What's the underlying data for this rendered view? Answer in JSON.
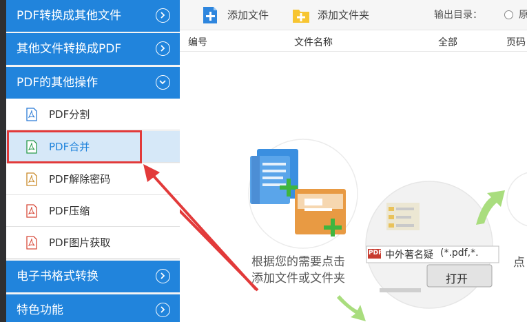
{
  "sidebar": {
    "categories_top": [
      {
        "label": "PDF转换成其他文件"
      },
      {
        "label": "其他文件转换成PDF"
      },
      {
        "label": "PDF的其他操作"
      }
    ],
    "sub_items": [
      {
        "label": "PDF分割",
        "icon": "pdf-file-icon",
        "color": "#2b7bd6"
      },
      {
        "label": "PDF合并",
        "icon": "pdf-file-icon",
        "color": "#2a9a4a"
      },
      {
        "label": "PDF解除密码",
        "icon": "pdf-file-icon",
        "color": "#c98a2a"
      },
      {
        "label": "PDF压缩",
        "icon": "pdf-file-icon",
        "color": "#d84a3a"
      },
      {
        "label": "PDF图片获取",
        "icon": "pdf-file-icon",
        "color": "#d84a3a"
      }
    ],
    "categories_bottom": [
      {
        "label": "电子书格式转换"
      },
      {
        "label": "特色功能"
      }
    ],
    "accent_color": "#2184dc",
    "active_item": "PDF合并"
  },
  "toolbar": {
    "add_file_label": "添加文件",
    "add_folder_label": "添加文件夹",
    "output_dir_label": "输出目录：",
    "output_option_label": "原"
  },
  "table": {
    "columns": [
      "编号",
      "文件名称",
      "全部",
      "页码"
    ]
  },
  "illustration": {
    "hint_line1": "根据您的需要点击",
    "hint_line2": "添加文件或文件夹",
    "hint_right": "点",
    "dialog_filename": "中外著名疑",
    "dialog_filter": "(*.pdf,*.",
    "dialog_open_button": "打开",
    "dialog_pdf_badge": "PDF"
  }
}
